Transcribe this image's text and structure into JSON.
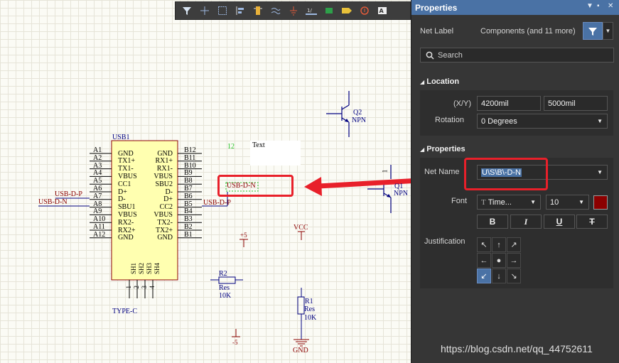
{
  "toolbar": {
    "buttons": [
      "filter-icon",
      "crosshair-icon",
      "select-rect-icon",
      "align-icon",
      "component-icon",
      "wire-icon",
      "ground-power-icon",
      "bus-icon",
      "sheet-symbol-icon",
      "port-icon",
      "no-erc-icon",
      "text-icon"
    ]
  },
  "schematic": {
    "usb": {
      "designator": "USB1",
      "footprint": "TYPE-C",
      "left_pins": [
        {
          "num": "A1",
          "name": "GND"
        },
        {
          "num": "A2",
          "name": "TX1+"
        },
        {
          "num": "A3",
          "name": "TX1-"
        },
        {
          "num": "A4",
          "name": "VBUS"
        },
        {
          "num": "A5",
          "name": "CC1"
        },
        {
          "num": "A6",
          "name": "D+"
        },
        {
          "num": "A7",
          "name": "D-"
        },
        {
          "num": "A8",
          "name": "SBU1"
        },
        {
          "num": "A9",
          "name": "VBUS"
        },
        {
          "num": "A10",
          "name": "RX2-"
        },
        {
          "num": "A11",
          "name": "RX2+"
        },
        {
          "num": "A12",
          "name": "GND"
        }
      ],
      "right_pins": [
        {
          "num": "B12",
          "name": "GND"
        },
        {
          "num": "B11",
          "name": "RX1+"
        },
        {
          "num": "B10",
          "name": "RX1-"
        },
        {
          "num": "B9",
          "name": "VBUS"
        },
        {
          "num": "B8",
          "name": "SBU2"
        },
        {
          "num": "B7",
          "name": "D-"
        },
        {
          "num": "B6",
          "name": "D+"
        },
        {
          "num": "B5",
          "name": "CC2"
        },
        {
          "num": "B4",
          "name": "VBUS"
        },
        {
          "num": "B3",
          "name": "TX2-"
        },
        {
          "num": "B2",
          "name": "TX2+"
        },
        {
          "num": "B1",
          "name": "GND"
        }
      ],
      "bottom_pins": [
        "SH1",
        "SH2",
        "SH3",
        "SH4"
      ],
      "bottom_nums": [
        "1",
        "2",
        "3",
        "4"
      ]
    },
    "net_labels": {
      "usb_d_p_left": "USB-D-P",
      "usb_d_n_left": "USB-D-N",
      "usb_d_p_right": "USB-D-P",
      "selected": "USB-D-N"
    },
    "text_12": "12",
    "text_obj": "Text",
    "q2": {
      "designator": "Q2",
      "type": "NPN"
    },
    "q1": {
      "designator": "Q1",
      "type": "NPN",
      "pin": "1"
    },
    "plus5": "+5",
    "minus5": "-5",
    "vcc": "VCC",
    "gnd": "GND",
    "r2": {
      "designator": "R2",
      "type": "Res",
      "value": "10K"
    },
    "r1": {
      "designator": "R1",
      "type": "Res",
      "value": "10K"
    }
  },
  "panel": {
    "title": "Properties",
    "filter_label": "Net Label",
    "filter_value": "Components (and 11 more)",
    "search_placeholder": "Search",
    "location": {
      "section": "Location",
      "xy_label": "(X/Y)",
      "x": "4200mil",
      "y": "5000mil",
      "rotation_label": "Rotation",
      "rotation": "0 Degrees"
    },
    "properties": {
      "section": "Properties",
      "net_name_label": "Net Name",
      "net_name": "U\\S\\B\\-D-N",
      "font_label": "Font",
      "font_name": "Time...",
      "font_size": "10",
      "font_color": "#8b0000",
      "bold": "B",
      "italic": "I",
      "underline": "U",
      "strike": "T",
      "justification_label": "Justification",
      "justification": [
        "↖",
        "↑",
        "↗",
        "←",
        "●",
        "→",
        "↙",
        "↓",
        "↘"
      ],
      "justification_selected": "bottom-left"
    }
  },
  "watermark": "https://blog.csdn.net/qq_44752611",
  "colors": {
    "accent": "#4a72a5",
    "highlight": "#e8202a",
    "wire": "#000080",
    "netlabel": "#8b0000"
  }
}
